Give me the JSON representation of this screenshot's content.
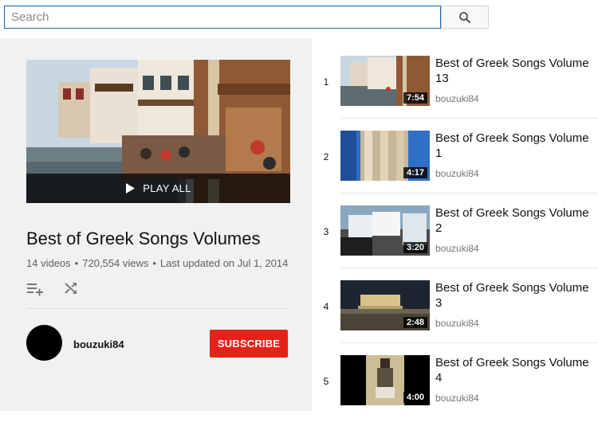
{
  "search": {
    "placeholder": "Search",
    "value": ""
  },
  "icons": {
    "search": "search-icon",
    "play": "play-icon",
    "add_queue": "add-to-queue-icon",
    "shuffle": "shuffle-icon"
  },
  "playlist": {
    "play_all_label": "PLAY ALL",
    "title": "Best of Greek Songs Volumes",
    "video_count": "14 videos",
    "views": "720,554 views",
    "updated": "Last updated on Jul 1, 2014",
    "owner": "bouzuki84",
    "subscribe_label": "SUBSCRIBE"
  },
  "videos": [
    {
      "index": "1",
      "title": "Best of Greek Songs Volume 13",
      "channel": "bouzuki84",
      "duration": "7:54"
    },
    {
      "index": "2",
      "title": "Best of Greek Songs Volume 1",
      "channel": "bouzuki84",
      "duration": "4:17"
    },
    {
      "index": "3",
      "title": "Best of Greek Songs Volume 2",
      "channel": "bouzuki84",
      "duration": "3:20"
    },
    {
      "index": "4",
      "title": "Best of Greek Songs Volume 3",
      "channel": "bouzuki84",
      "duration": "2:48"
    },
    {
      "index": "5",
      "title": "Best of Greek Songs Volume 4",
      "channel": "bouzuki84",
      "duration": "4:00"
    }
  ],
  "colors": {
    "subscribe": "#e62117",
    "search_border": "#1c62b9",
    "panel_bg": "#f1f1f1"
  }
}
